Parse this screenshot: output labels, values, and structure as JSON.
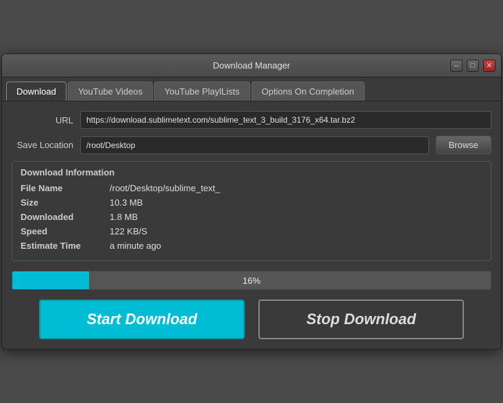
{
  "window": {
    "title": "Download Manager"
  },
  "titlebar": {
    "minimize_label": "–",
    "maximize_label": "□",
    "close_label": "✕"
  },
  "tabs": [
    {
      "id": "download",
      "label": "Download",
      "active": true
    },
    {
      "id": "youtube-videos",
      "label": "YouTube Videos",
      "active": false
    },
    {
      "id": "youtube-playlists",
      "label": "YouTube PlaylLists",
      "active": false
    },
    {
      "id": "options",
      "label": "Options On Completion",
      "active": false
    }
  ],
  "form": {
    "url_label": "URL",
    "url_value": "https://download.sublimetext.com/sublime_text_3_build_3176_x64.tar.bz2",
    "save_location_label": "Save Location",
    "save_location_value": "/root/Desktop",
    "browse_label": "Browse"
  },
  "info_panel": {
    "title": "Download Information",
    "file_name_key": "File Name",
    "file_name_value": "/root/Desktop/sublime_text_",
    "size_key": "Size",
    "size_value": "10.3 MB",
    "downloaded_key": "Downloaded",
    "downloaded_value": "1.8 MB",
    "speed_key": "Speed",
    "speed_value": "122  KB/S",
    "estimate_key": "Estimate Time",
    "estimate_value": "a minute ago"
  },
  "progress": {
    "percent": 16,
    "label": "16%"
  },
  "buttons": {
    "start_label": "Start Download",
    "stop_label": "Stop Download"
  }
}
